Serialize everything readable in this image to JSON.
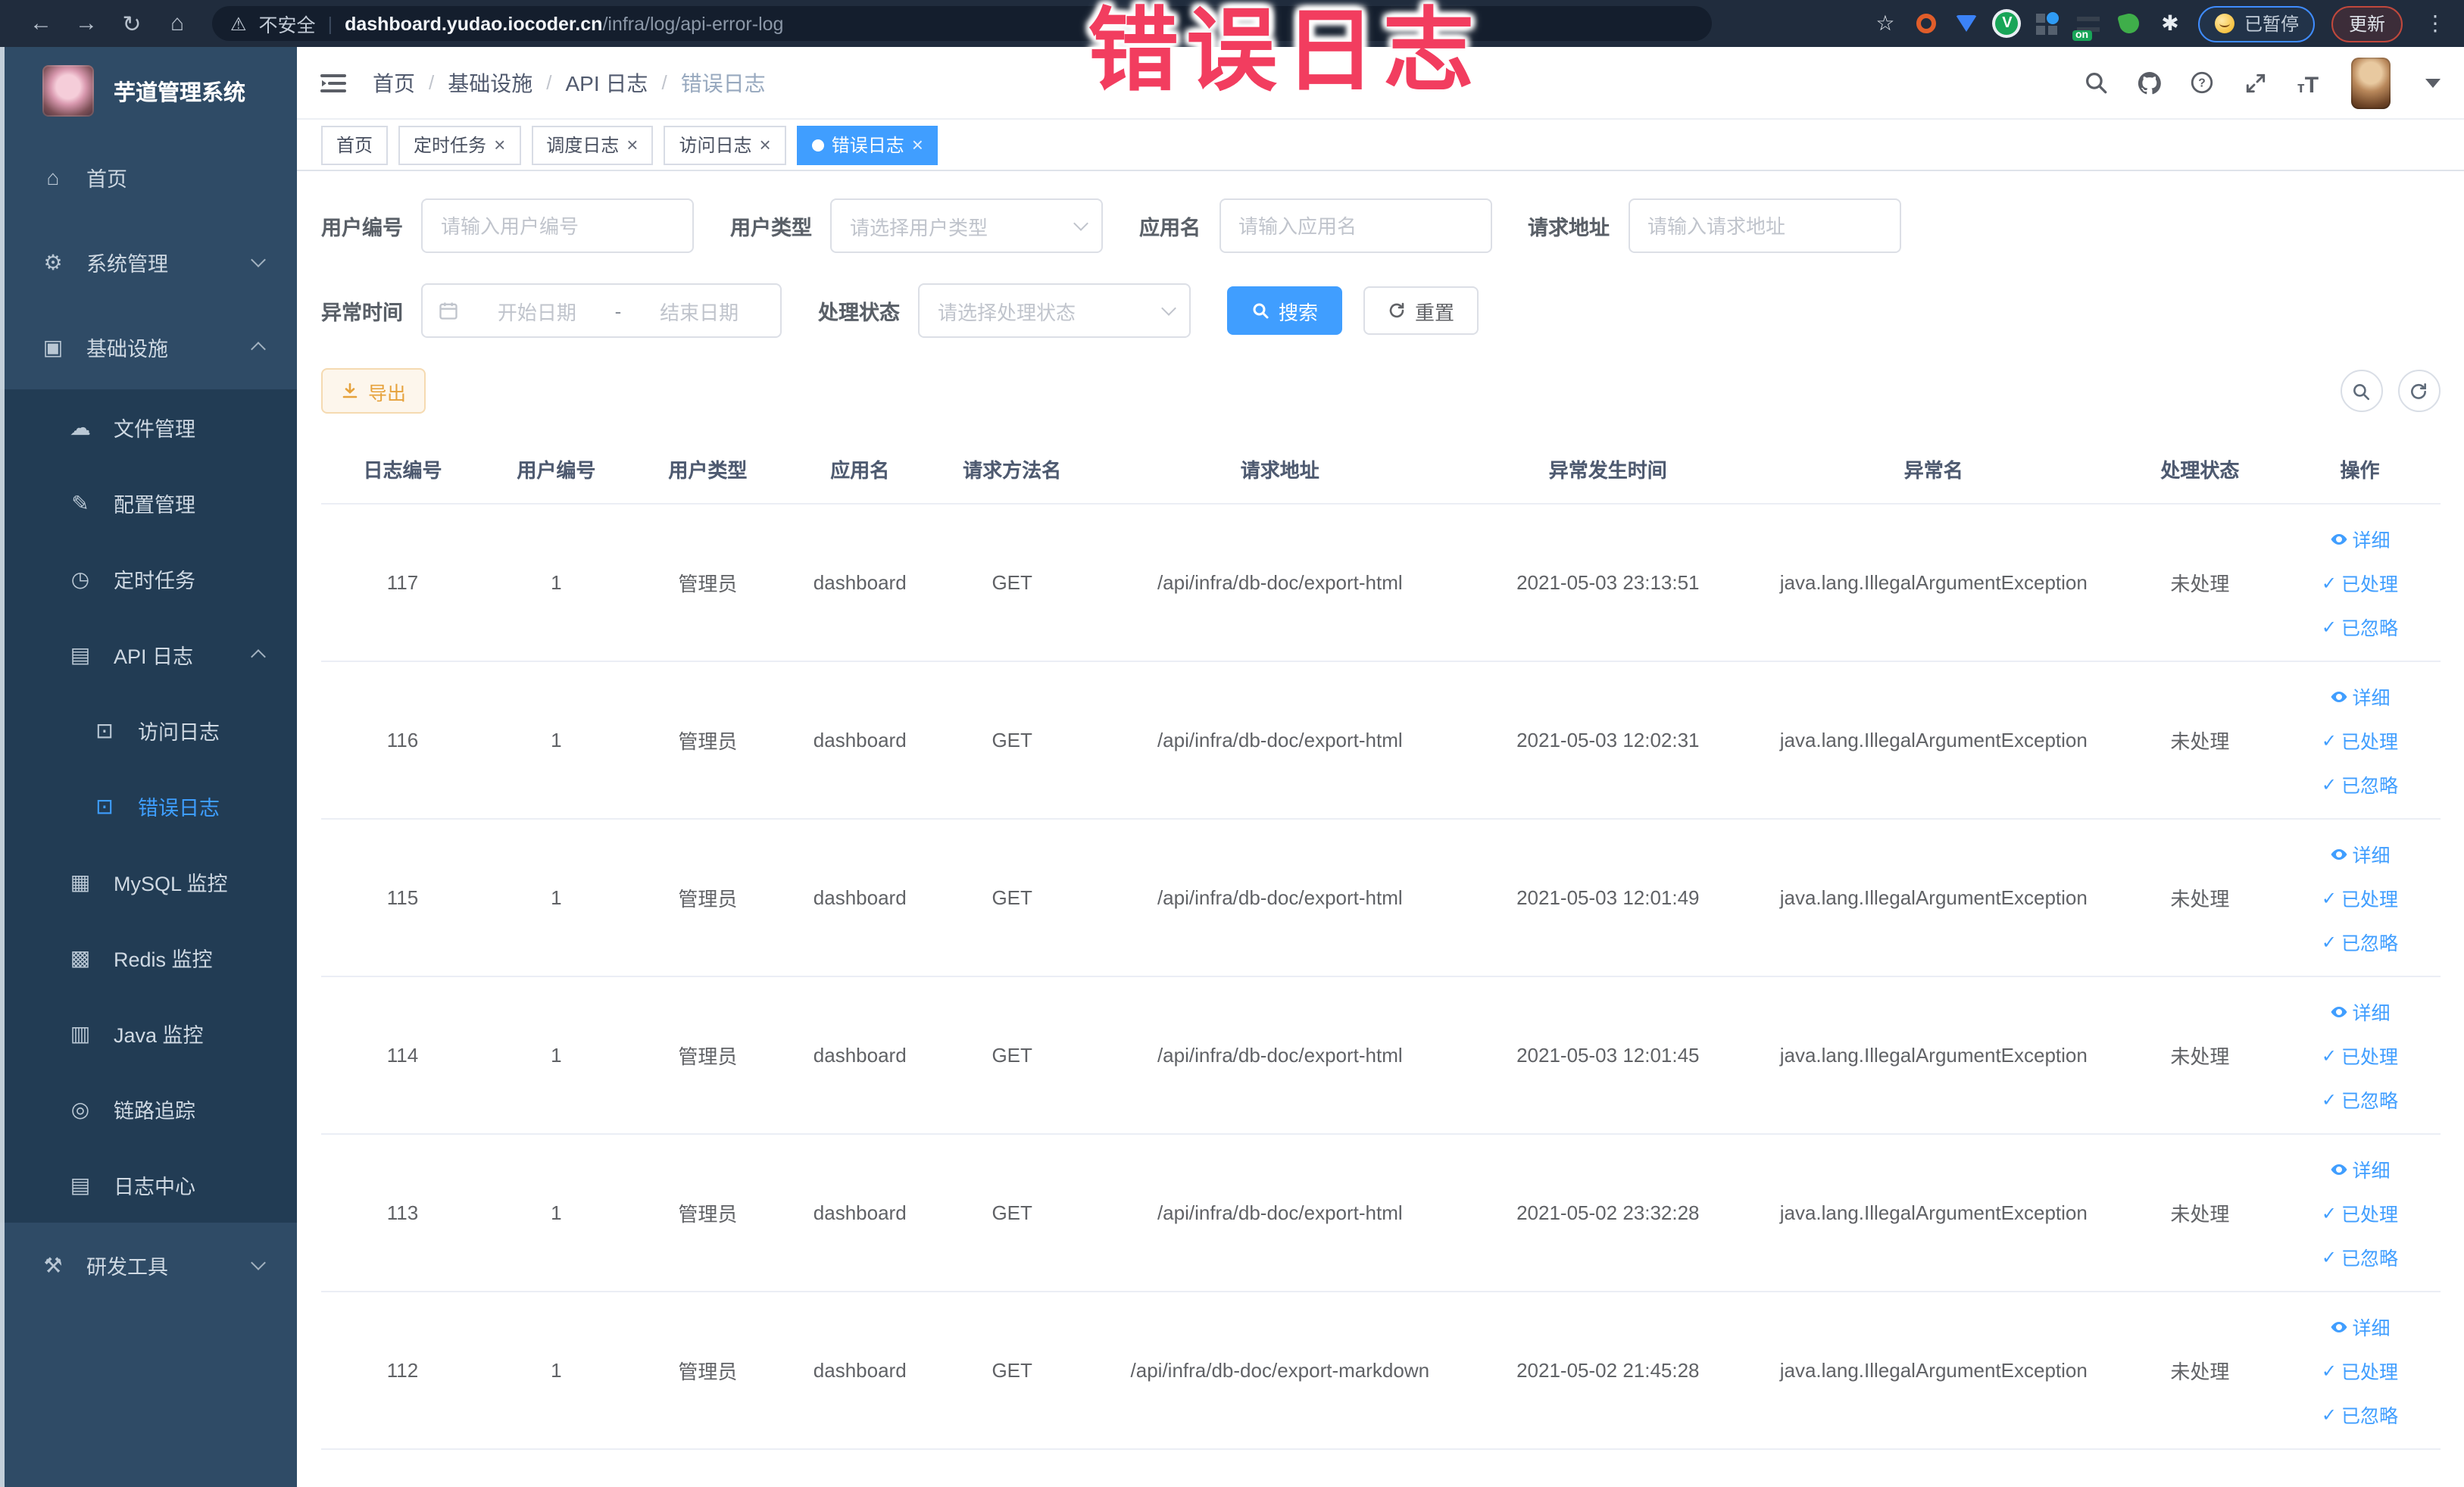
{
  "browser": {
    "security_label": "不安全",
    "url_domain": "dashboard.yudao.iocoder.cn",
    "url_path": "/infra/log/api-error-log",
    "paused_badge": "已暂停",
    "update_badge": "更新",
    "kebab": "⋮"
  },
  "overlay": {
    "text": "错误日志",
    "color": "#f23d5f"
  },
  "sidebar": {
    "title": "芋道管理系统",
    "items": [
      {
        "label": "首页",
        "icon": "home-icon",
        "level": 1
      },
      {
        "label": "系统管理",
        "icon": "gear-icon",
        "level": 1,
        "chevron": "down"
      },
      {
        "label": "基础设施",
        "icon": "infrastructure-icon",
        "level": 1,
        "chevron": "up"
      },
      {
        "label": "文件管理",
        "icon": "file-manage-icon",
        "level": 2
      },
      {
        "label": "配置管理",
        "icon": "config-manage-icon",
        "level": 2
      },
      {
        "label": "定时任务",
        "icon": "timer-task-icon",
        "level": 2
      },
      {
        "label": "API 日志",
        "icon": "api-log-icon",
        "level": 2,
        "chevron": "up"
      },
      {
        "label": "访问日志",
        "icon": "access-log-icon",
        "level": 3
      },
      {
        "label": "错误日志",
        "icon": "error-log-icon",
        "level": 3,
        "active": true
      },
      {
        "label": "MySQL 监控",
        "icon": "mysql-monitor-icon",
        "level": 2
      },
      {
        "label": "Redis 监控",
        "icon": "redis-monitor-icon",
        "level": 2
      },
      {
        "label": "Java 监控",
        "icon": "java-monitor-icon",
        "level": 2
      },
      {
        "label": "链路追踪",
        "icon": "trace-icon",
        "level": 2
      },
      {
        "label": "日志中心",
        "icon": "log-center-icon",
        "level": 2
      },
      {
        "label": "研发工具",
        "icon": "devtools-icon",
        "level": 1,
        "chevron": "down"
      }
    ]
  },
  "header": {
    "breadcrumb": [
      "首页",
      "基础设施",
      "API 日志",
      "错误日志"
    ],
    "separator": "/"
  },
  "tabs": [
    {
      "label": "首页",
      "closable": false,
      "active": false
    },
    {
      "label": "定时任务",
      "closable": true,
      "active": false
    },
    {
      "label": "调度日志",
      "closable": true,
      "active": false
    },
    {
      "label": "访问日志",
      "closable": true,
      "active": false
    },
    {
      "label": "错误日志",
      "closable": true,
      "active": true
    }
  ],
  "filters": {
    "user_id_label": "用户编号",
    "user_id_placeholder": "请输入用户编号",
    "user_type_label": "用户类型",
    "user_type_placeholder": "请选择用户类型",
    "app_name_label": "应用名",
    "app_name_placeholder": "请输入应用名",
    "request_url_label": "请求地址",
    "request_url_placeholder": "请输入请求地址",
    "exception_time_label": "异常时间",
    "start_date_placeholder": "开始日期",
    "range_separator": "-",
    "end_date_placeholder": "结束日期",
    "process_status_label": "处理状态",
    "process_status_placeholder": "请选择处理状态",
    "search_label": "搜索",
    "reset_label": "重置"
  },
  "toolbar": {
    "export_label": "导出"
  },
  "table": {
    "columns": [
      "日志编号",
      "用户编号",
      "用户类型",
      "应用名",
      "请求方法名",
      "请求地址",
      "异常发生时间",
      "异常名",
      "处理状态",
      "操作"
    ],
    "actions": [
      "详细",
      "已处理",
      "已忽略"
    ],
    "rows": [
      {
        "id": "117",
        "user_id": "1",
        "user_type": "管理员",
        "app": "dashboard",
        "method": "GET",
        "url": "/api/infra/db-doc/export-html",
        "time": "2021-05-03 23:13:51",
        "exception": "java.lang.IllegalArgumentException",
        "status": "未处理"
      },
      {
        "id": "116",
        "user_id": "1",
        "user_type": "管理员",
        "app": "dashboard",
        "method": "GET",
        "url": "/api/infra/db-doc/export-html",
        "time": "2021-05-03 12:02:31",
        "exception": "java.lang.IllegalArgumentException",
        "status": "未处理"
      },
      {
        "id": "115",
        "user_id": "1",
        "user_type": "管理员",
        "app": "dashboard",
        "method": "GET",
        "url": "/api/infra/db-doc/export-html",
        "time": "2021-05-03 12:01:49",
        "exception": "java.lang.IllegalArgumentException",
        "status": "未处理"
      },
      {
        "id": "114",
        "user_id": "1",
        "user_type": "管理员",
        "app": "dashboard",
        "method": "GET",
        "url": "/api/infra/db-doc/export-html",
        "time": "2021-05-03 12:01:45",
        "exception": "java.lang.IllegalArgumentException",
        "status": "未处理"
      },
      {
        "id": "113",
        "user_id": "1",
        "user_type": "管理员",
        "app": "dashboard",
        "method": "GET",
        "url": "/api/infra/db-doc/export-html",
        "time": "2021-05-02 23:32:28",
        "exception": "java.lang.IllegalArgumentException",
        "status": "未处理"
      },
      {
        "id": "112",
        "user_id": "1",
        "user_type": "管理员",
        "app": "dashboard",
        "method": "GET",
        "url": "/api/infra/db-doc/export-markdown",
        "time": "2021-05-02 21:45:28",
        "exception": "java.lang.IllegalArgumentException",
        "status": "未处理"
      }
    ]
  },
  "colors": {
    "primary": "#409eff",
    "warning": "#e6a23c",
    "overlay_red": "#f23d5f"
  }
}
